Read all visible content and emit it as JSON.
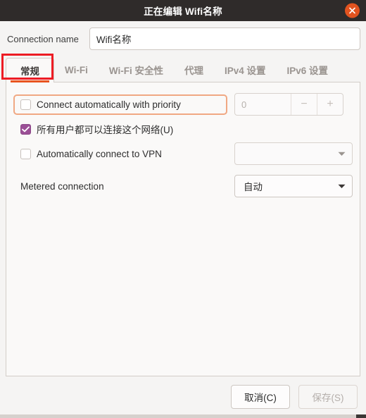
{
  "window": {
    "title": "正在编辑 Wifi名称",
    "close_icon": "close-icon"
  },
  "connection": {
    "label": "Connection name",
    "value": "Wifi名称",
    "placeholder": ""
  },
  "tabs": [
    {
      "label": "常规",
      "active": true
    },
    {
      "label": "Wi-Fi",
      "active": false
    },
    {
      "label": "Wi-Fi 安全性",
      "active": false
    },
    {
      "label": "代理",
      "active": false
    },
    {
      "label": "IPv4 设置",
      "active": false
    },
    {
      "label": "IPv6 设置",
      "active": false
    }
  ],
  "general_tab": {
    "auto_connect": {
      "label": "Connect automatically with priority",
      "checked": false,
      "priority_value": "0",
      "minus_label": "−",
      "plus_label": "+"
    },
    "all_users": {
      "label": "所有用户都可以连接这个网络(U)",
      "checked": true
    },
    "auto_vpn": {
      "label": "Automatically connect to VPN",
      "checked": false,
      "vpn_combo_value": ""
    },
    "metered": {
      "label": "Metered connection",
      "combo_value": "自动"
    }
  },
  "footer": {
    "cancel_label": "取消(C)",
    "save_label": "保存(S)"
  },
  "colors": {
    "titlebar_bg": "#2f2b2a",
    "close_button": "#e2531f",
    "accent_orange": "#e95420",
    "checkbox_purple": "#9b4f96",
    "annotation_red": "#ed1c24",
    "focus_ring": "#f0a883"
  }
}
